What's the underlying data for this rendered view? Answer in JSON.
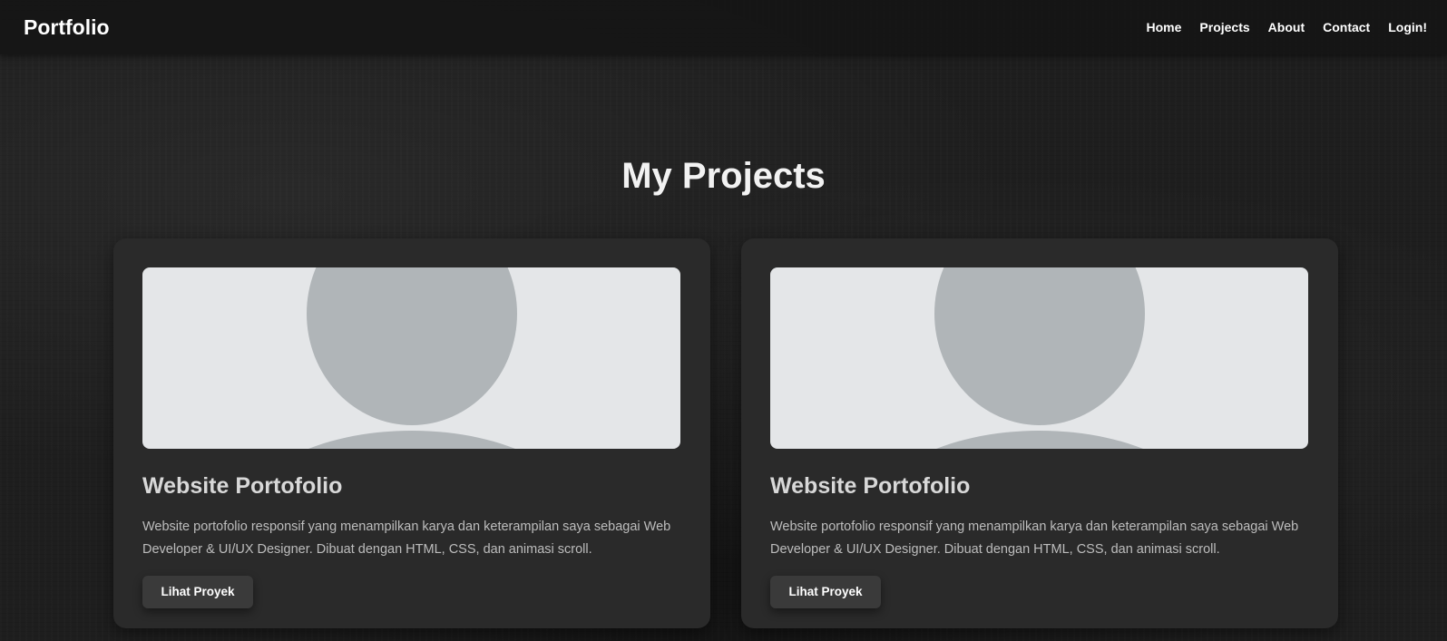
{
  "header": {
    "logo": "Portfolio",
    "nav": [
      {
        "label": "Home"
      },
      {
        "label": "Projects"
      },
      {
        "label": "About"
      },
      {
        "label": "Contact"
      },
      {
        "label": "Login!"
      }
    ]
  },
  "projects_section": {
    "title": "My Projects",
    "cards": [
      {
        "image_icon": "avatar-placeholder-icon",
        "title": "Website Portofolio",
        "description": "Website portofolio responsif yang menampilkan karya dan keterampilan saya sebagai Web Developer & UI/UX Designer. Dibuat dengan HTML, CSS, dan animasi scroll.",
        "button_label": "Lihat Proyek"
      },
      {
        "image_icon": "avatar-placeholder-icon",
        "title": "Website Portofolio",
        "description": "Website portofolio responsif yang menampilkan karya dan keterampilan saya sebagai Web Developer & UI/UX Designer. Dibuat dengan HTML, CSS, dan animasi scroll.",
        "button_label": "Lihat Proyek"
      }
    ]
  },
  "colors": {
    "background": "#1e1e1e",
    "card_background": "#2a2a2a",
    "navbar_background": "#141414",
    "button_background": "#3a3a3a",
    "placeholder_light": "#e4e6e8",
    "placeholder_dark": "#b0b5b8"
  }
}
